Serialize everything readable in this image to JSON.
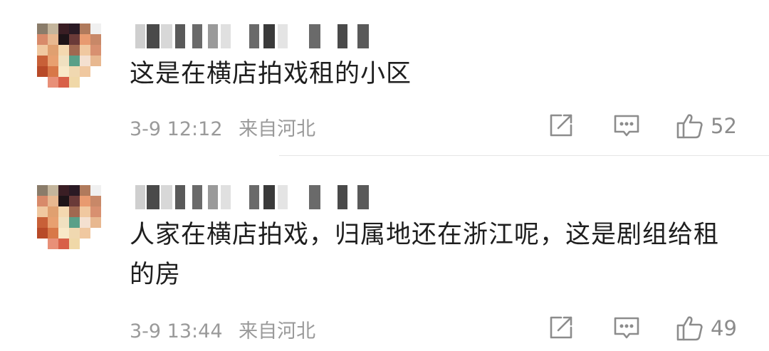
{
  "comments": [
    {
      "text": "这是在横店拍戏租的小区",
      "date": "3-9 12:12",
      "location": "来自河北",
      "likes": "52"
    },
    {
      "text": "人家在横店拍戏，归属地还在浙江呢，这是剧组给租的房",
      "date": "3-9 13:44",
      "location": "来自河北",
      "likes": "49"
    }
  ],
  "icons": {
    "share": "share-icon",
    "reply": "comment-icon",
    "like": "thumbs-up-icon"
  },
  "colors": {
    "meta_text": "#9a9a9a",
    "icon": "#8c8c8c",
    "divider": "#e6e6e6"
  }
}
